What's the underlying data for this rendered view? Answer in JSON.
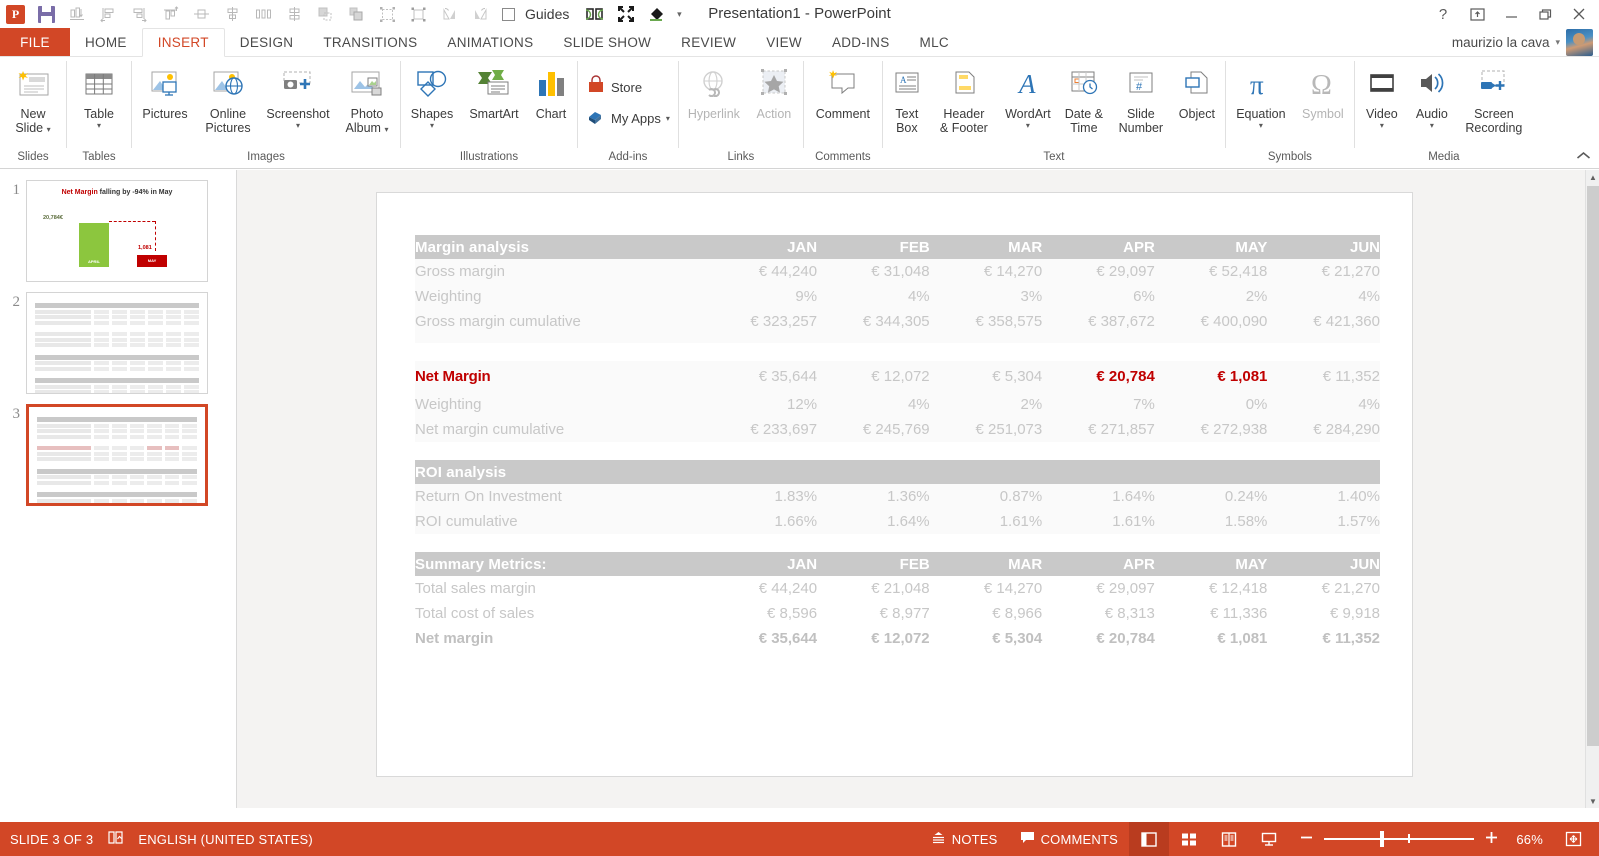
{
  "window": {
    "title": "Presentation1 - PowerPoint",
    "help_icon": "?",
    "ribbon_display_icon": "ribbon-display-options-icon",
    "minimize_icon": "minimize-icon",
    "restore_icon": "restore-icon",
    "close_icon": "close-icon"
  },
  "quick_access": {
    "app_logo": "powerpoint-logo",
    "items": [
      {
        "name": "save-icon",
        "label": "Save"
      },
      {
        "name": "align-distribute-icon",
        "label": "Distribute"
      },
      {
        "name": "align-left-icon",
        "label": "Align Left"
      },
      {
        "name": "align-right-icon",
        "label": "Align Right"
      },
      {
        "name": "align-top-icon",
        "label": "Align Top"
      },
      {
        "name": "align-middle-icon",
        "label": "Align Middle"
      },
      {
        "name": "align-center-icon",
        "label": "Align Center"
      },
      {
        "name": "distribute-horizontally-icon",
        "label": "Distribute Horizontally"
      },
      {
        "name": "distribute-vertically-icon",
        "label": "Distribute Vertically"
      },
      {
        "name": "bring-forward-icon",
        "label": "Bring Forward"
      },
      {
        "name": "send-backward-icon",
        "label": "Send Backward"
      },
      {
        "name": "selection-pane-icon",
        "label": "Selection Pane"
      },
      {
        "name": "group-objects-icon",
        "label": "Group"
      },
      {
        "name": "flip-horizontal-icon",
        "label": "Flip Horizontal"
      },
      {
        "name": "flip-vertical-icon",
        "label": "Flip Vertical"
      }
    ],
    "guides_label": "Guides",
    "guides_checked": false,
    "compare_icon": "compare-side-by-side-icon",
    "fullscreen_icon": "fullscreen-icon",
    "format-painter_icon": "eyedropper-icon",
    "more_icon": "customize-quick-access-toolbar-icon"
  },
  "tabs": {
    "file": "FILE",
    "items": [
      "HOME",
      "INSERT",
      "DESIGN",
      "TRANSITIONS",
      "ANIMATIONS",
      "SLIDE SHOW",
      "REVIEW",
      "VIEW",
      "ADD-INS",
      "MLC"
    ],
    "active": "INSERT"
  },
  "account": {
    "user_name": "maurizio la cava",
    "caret": "▾"
  },
  "ribbon": {
    "collapse_icon": "collapse-ribbon-icon",
    "groups": [
      {
        "label": "Slides",
        "items": [
          {
            "name": "new-slide-button",
            "label": "New\nSlide",
            "icon": "new-slide-icon",
            "dropdown": true,
            "disabled": false
          }
        ]
      },
      {
        "label": "Tables",
        "items": [
          {
            "name": "table-button",
            "label": "Table",
            "icon": "table-icon",
            "dropdown": true,
            "disabled": false
          }
        ]
      },
      {
        "label": "Images",
        "items": [
          {
            "name": "pictures-button",
            "label": "Pictures",
            "icon": "pictures-icon",
            "dropdown": false,
            "disabled": false
          },
          {
            "name": "online-pictures-button",
            "label": "Online\nPictures",
            "icon": "online-pictures-icon",
            "dropdown": false,
            "disabled": false
          },
          {
            "name": "screenshot-button",
            "label": "Screenshot",
            "icon": "screenshot-icon",
            "dropdown": true,
            "disabled": false
          },
          {
            "name": "photo-album-button",
            "label": "Photo\nAlbum",
            "icon": "photo-album-icon",
            "dropdown": true,
            "disabled": false
          }
        ]
      },
      {
        "label": "Illustrations",
        "items": [
          {
            "name": "shapes-button",
            "label": "Shapes",
            "icon": "shapes-icon",
            "dropdown": true,
            "disabled": false
          },
          {
            "name": "smartart-button",
            "label": "SmartArt",
            "icon": "smartart-icon",
            "dropdown": false,
            "disabled": false
          },
          {
            "name": "chart-button",
            "label": "Chart",
            "icon": "chart-icon",
            "dropdown": false,
            "disabled": false
          }
        ]
      },
      {
        "label": "Add-ins",
        "items": [
          {
            "name": "store-button",
            "label": "Store",
            "icon": "store-icon",
            "dropdown": false,
            "disabled": false
          },
          {
            "name": "my-apps-button",
            "label": "My Apps",
            "icon": "my-apps-icon",
            "dropdown": true,
            "disabled": false
          }
        ]
      },
      {
        "label": "Links",
        "items": [
          {
            "name": "hyperlink-button",
            "label": "Hyperlink",
            "icon": "hyperlink-icon",
            "dropdown": false,
            "disabled": true
          },
          {
            "name": "action-button",
            "label": "Action",
            "icon": "action-icon",
            "dropdown": false,
            "disabled": true
          }
        ]
      },
      {
        "label": "Comments",
        "items": [
          {
            "name": "comment-button",
            "label": "Comment",
            "icon": "comment-icon",
            "dropdown": false,
            "disabled": false
          }
        ]
      },
      {
        "label": "Text",
        "items": [
          {
            "name": "text-box-button",
            "label": "Text\nBox",
            "icon": "text-box-icon",
            "dropdown": false,
            "disabled": false
          },
          {
            "name": "header-footer-button",
            "label": "Header\n& Footer",
            "icon": "header-footer-icon",
            "dropdown": false,
            "disabled": false
          },
          {
            "name": "wordart-button",
            "label": "WordArt",
            "icon": "wordart-icon",
            "dropdown": true,
            "disabled": false
          },
          {
            "name": "date-time-button",
            "label": "Date &\nTime",
            "icon": "date-time-icon",
            "dropdown": false,
            "disabled": false
          },
          {
            "name": "slide-number-button",
            "label": "Slide\nNumber",
            "icon": "slide-number-icon",
            "dropdown": false,
            "disabled": false
          },
          {
            "name": "object-button",
            "label": "Object",
            "icon": "object-icon",
            "dropdown": false,
            "disabled": false
          }
        ]
      },
      {
        "label": "Symbols",
        "items": [
          {
            "name": "equation-button",
            "label": "Equation",
            "icon": "equation-icon",
            "dropdown": true,
            "disabled": false
          },
          {
            "name": "symbol-button",
            "label": "Symbol",
            "icon": "symbol-icon",
            "dropdown": false,
            "disabled": true
          }
        ]
      },
      {
        "label": "Media",
        "items": [
          {
            "name": "video-button",
            "label": "Video",
            "icon": "video-icon",
            "dropdown": true,
            "disabled": false
          },
          {
            "name": "audio-button",
            "label": "Audio",
            "icon": "audio-icon",
            "dropdown": true,
            "disabled": false
          },
          {
            "name": "screen-recording-button",
            "label": "Screen\nRecording",
            "icon": "screen-recording-icon",
            "dropdown": false,
            "disabled": false
          }
        ]
      }
    ]
  },
  "slide_panel": {
    "thumbnails": [
      {
        "number": "1",
        "selected": false,
        "type": "chart"
      },
      {
        "number": "2",
        "selected": false,
        "type": "table"
      },
      {
        "number": "3",
        "selected": true,
        "type": "table-red"
      }
    ],
    "thumb1_chart": {
      "title_red": "Net Margin",
      "title_rest": " falling by -94% in May",
      "bar1_label": "20,784€",
      "bar1_category": "APRIL",
      "bar2_label": "1,081",
      "bar2_category": "MAY"
    }
  },
  "slide": {
    "sections": [
      {
        "name": "margin-analysis",
        "header": {
          "label": "Margin analysis",
          "months": [
            "JAN",
            "FEB",
            "MAR",
            "APR",
            "MAY",
            "JUN"
          ]
        },
        "rows": [
          {
            "label": "Gross margin",
            "values": [
              "€ 44,240",
              "€ 31,048",
              "€ 14,270",
              "€ 29,097",
              "€ 52,418",
              "€ 21,270"
            ],
            "style": "normal"
          },
          {
            "label": "Weighting",
            "values": [
              "9%",
              "4%",
              "3%",
              "6%",
              "2%",
              "4%"
            ],
            "style": "normal"
          },
          {
            "label": "Gross margin cumulative",
            "values": [
              "€ 323,257",
              "€ 344,305",
              "€ 358,575",
              "€ 387,672",
              "€ 400,090",
              "€ 421,360"
            ],
            "style": "normal"
          }
        ]
      },
      {
        "name": "net-margin",
        "rows": [
          {
            "label": "Net Margin",
            "values": [
              "€ 35,644",
              "€ 12,072",
              "€ 5,304",
              "€ 20,784",
              "€ 1,081",
              "€ 11,352"
            ],
            "style": "highlight",
            "highlight_cols": [
              3,
              4
            ]
          },
          {
            "label": "Weighting",
            "values": [
              "12%",
              "4%",
              "2%",
              "7%",
              "0%",
              "4%"
            ],
            "style": "normal"
          },
          {
            "label": "Net margin cumulative",
            "values": [
              "€ 233,697",
              "€ 245,769",
              "€ 251,073",
              "€ 271,857",
              "€ 272,938",
              "€ 284,290"
            ],
            "style": "normal"
          }
        ]
      },
      {
        "name": "roi-analysis",
        "header": {
          "label": "ROI analysis",
          "months": [
            "",
            "",
            "",
            "",
            "",
            ""
          ]
        },
        "rows": [
          {
            "label": "Return On Investment",
            "values": [
              "1.83%",
              "1.36%",
              "0.87%",
              "1.64%",
              "0.24%",
              "1.40%"
            ],
            "style": "normal"
          },
          {
            "label": "ROI cumulative",
            "values": [
              "1.66%",
              "1.64%",
              "1.61%",
              "1.61%",
              "1.58%",
              "1.57%"
            ],
            "style": "normal"
          }
        ]
      },
      {
        "name": "summary-metrics",
        "header": {
          "label": "Summary Metrics:",
          "months": [
            "JAN",
            "FEB",
            "MAR",
            "APR",
            "MAY",
            "JUN"
          ]
        },
        "rows": [
          {
            "label": "Total sales margin",
            "values": [
              "€ 44,240",
              "€ 21,048",
              "€ 14,270",
              "€ 29,097",
              "€ 12,418",
              "€ 21,270"
            ],
            "style": "normal"
          },
          {
            "label": "Total cost of sales",
            "values": [
              "€ 8,596",
              "€ 8,977",
              "€ 8,966",
              "€ 8,313",
              "€ 11,336",
              "€ 9,918"
            ],
            "style": "normal"
          },
          {
            "label": "Net margin",
            "values": [
              "€ 35,644",
              "€ 12,072",
              "€ 5,304",
              "€ 20,784",
              "€ 1,081",
              "€ 11,352"
            ],
            "style": "bold"
          }
        ]
      }
    ]
  },
  "status_bar": {
    "slide_indicator": "SLIDE 3 OF 3",
    "language_icon": "spell-check-icon",
    "language": "ENGLISH (UNITED STATES)",
    "notes_label": "NOTES",
    "notes_icon": "notes-icon",
    "comments_label": "COMMENTS",
    "comments_icon": "comments-icon",
    "views": [
      {
        "name": "normal-view-button",
        "icon": "normal-view-icon",
        "active": true
      },
      {
        "name": "slide-sorter-button",
        "icon": "slide-sorter-icon",
        "active": false
      },
      {
        "name": "reading-view-button",
        "icon": "reading-view-icon",
        "active": false
      },
      {
        "name": "slide-show-button",
        "icon": "slide-show-icon",
        "active": false
      }
    ],
    "zoom_out_icon": "zoom-out-icon",
    "zoom_in_icon": "zoom-in-icon",
    "zoom_level": "66%",
    "fit_slide_icon": "fit-slide-to-window-icon"
  },
  "colors": {
    "accent": "#d24726",
    "highlight_red": "#c00000",
    "table_header": "#c9c9c9",
    "table_text": "#c7c7c7"
  }
}
